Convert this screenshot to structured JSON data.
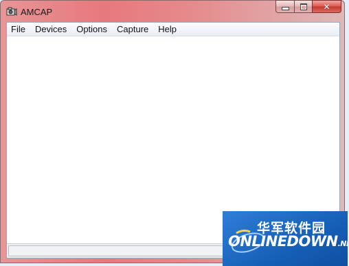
{
  "window": {
    "title": "AMCAP"
  },
  "menubar": {
    "items": [
      "File",
      "Devices",
      "Options",
      "Capture",
      "Help"
    ]
  },
  "watermark": {
    "chinese": "华军软件园",
    "english": "ONLINEDOWN",
    "suffix": ".NET"
  },
  "icons": {
    "app": "camera-app-icon",
    "minimize": "minimize-icon",
    "maximize": "maximize-icon",
    "close": "close-icon"
  }
}
